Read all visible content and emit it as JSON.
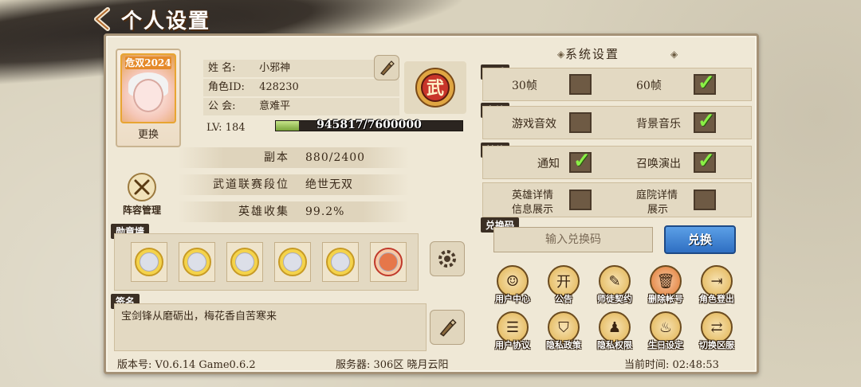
{
  "header": {
    "title": "个人设置"
  },
  "profile": {
    "avatar_badge": "危双2024",
    "change_label": "更换",
    "name_key": "姓  名:",
    "name": "小邪神",
    "id_key": "角色ID:",
    "id": "428230",
    "guild_key": "公  会:",
    "guild": "意难平",
    "lv_label": "LV: 184",
    "exp_text": "945817/7600000",
    "exp_progress": 0.124,
    "rank_glyph": "武"
  },
  "stats": [
    {
      "key": "副本",
      "value": "880/2400"
    },
    {
      "key": "武道联赛段位",
      "value": "绝世无双"
    },
    {
      "key": "英雄收集",
      "value": "99.2%"
    }
  ],
  "lineup": {
    "label": "阵容管理"
  },
  "medals": {
    "section": "勋章墙",
    "items": [
      "medal-1",
      "medal-2",
      "medal-3",
      "medal-4",
      "medal-5",
      "medal-6"
    ]
  },
  "signature": {
    "section": "签名",
    "text": "宝剑锋从磨砺出，梅花香自苦寒来"
  },
  "footer": {
    "version": "版本号: V0.6.14 Game0.6.2",
    "server": "服务器: 306区 晓月云阳",
    "time": "当前时间: 02:48:53"
  },
  "system": {
    "title": "系统设置",
    "quality": {
      "section": "画质",
      "opt1": "30帧",
      "opt1_on": false,
      "opt2": "60帧",
      "opt2_on": true
    },
    "sound": {
      "section": "音效",
      "opt1": "游戏音效",
      "opt1_on": false,
      "opt2": "背景音乐",
      "opt2_on": true
    },
    "other": {
      "section": "其他",
      "opt1": "通知",
      "opt1_on": true,
      "opt2": "召唤演出",
      "opt2_on": true
    },
    "detail": {
      "opt1_l1": "英雄详情",
      "opt1_l2": "信息展示",
      "opt1_on": false,
      "opt2_l1": "庭院详情",
      "opt2_l2": "展示",
      "opt2_on": false
    },
    "redeem": {
      "section": "兑换码",
      "placeholder": "输入兑换码",
      "button": "兑换"
    },
    "buttons_row1": [
      "用户中心",
      "公告",
      "师徒契约",
      "删除帐号",
      "角色登出"
    ],
    "buttons_row2": [
      "用户协议",
      "隐私政策",
      "隐私权限",
      "生日设定",
      "切换区服"
    ]
  }
}
